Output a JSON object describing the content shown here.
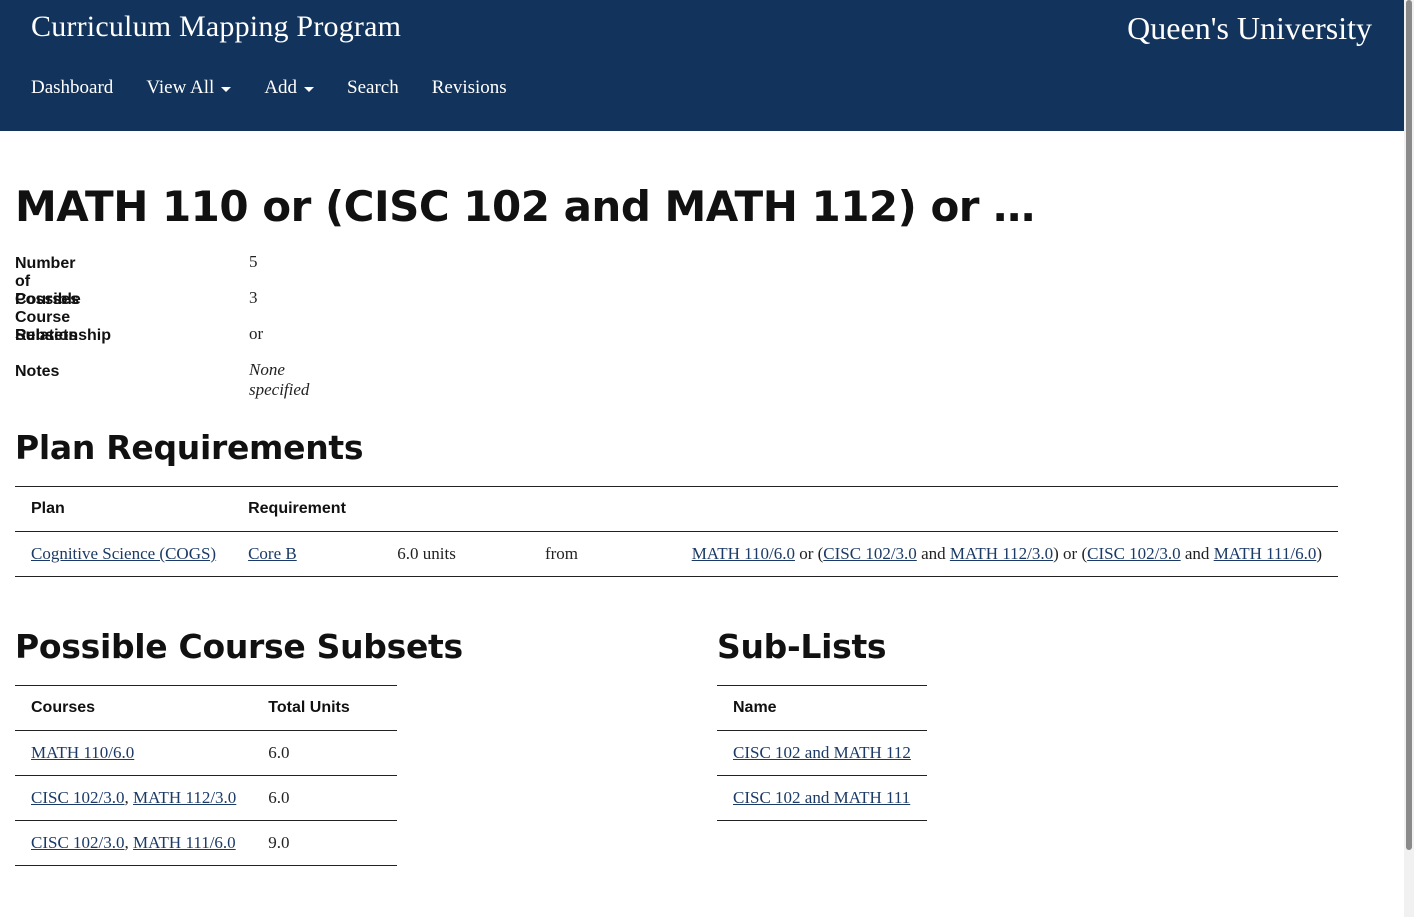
{
  "header": {
    "app_title": "Curriculum Mapping Program",
    "university": "Queen's University",
    "nav": [
      {
        "label": "Dashboard",
        "dropdown": false
      },
      {
        "label": "View All",
        "dropdown": true
      },
      {
        "label": "Add",
        "dropdown": true
      },
      {
        "label": "Search",
        "dropdown": false
      },
      {
        "label": "Revisions",
        "dropdown": false
      }
    ]
  },
  "page": {
    "title": "MATH 110 or (CISC 102 and MATH 112) or …",
    "properties": [
      {
        "label": "Number of Courses",
        "value": "5"
      },
      {
        "label": "Possible Course Subsets",
        "value": "3"
      },
      {
        "label": "Relationship",
        "value": "or"
      },
      {
        "label": "Notes",
        "value": "None specified"
      }
    ]
  },
  "plan_requirements": {
    "heading": "Plan Requirements",
    "columns": [
      "Plan",
      "Requirement"
    ],
    "row": {
      "plan": "Cognitive Science (COGS)",
      "requirement": "Core B",
      "units": "6.0 units",
      "from": "from",
      "expr": {
        "c1": "MATH 110/6.0",
        "t1": " or (",
        "c2": "CISC 102/3.0",
        "t2": " and ",
        "c3": "MATH 112/3.0",
        "t3": ") or (",
        "c4": "CISC 102/3.0",
        "t4": " and ",
        "c5": "MATH 111/6.0",
        "t5": ")"
      }
    }
  },
  "subsets": {
    "heading": "Possible Course Subsets",
    "columns": [
      "Courses",
      "Total Units"
    ],
    "rows": [
      {
        "c1": "MATH 110/6.0",
        "sep": "",
        "c2": "",
        "units": "6.0"
      },
      {
        "c1": "CISC 102/3.0",
        "sep": ", ",
        "c2": "MATH 112/3.0",
        "units": "6.0"
      },
      {
        "c1": "CISC 102/3.0",
        "sep": ", ",
        "c2": "MATH 111/6.0",
        "units": "9.0"
      }
    ]
  },
  "sublists": {
    "heading": "Sub-Lists",
    "columns": [
      "Name"
    ],
    "rows": [
      "CISC 102 and MATH 112",
      "CISC 102 and MATH 111"
    ]
  }
}
